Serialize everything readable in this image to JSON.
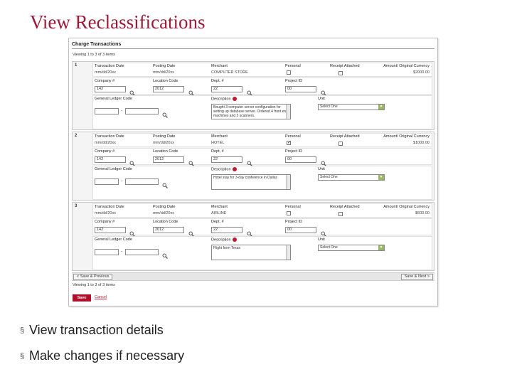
{
  "slide": {
    "title": "View Reclassifications",
    "bullets": [
      "View transaction details",
      "Make changes if necessary"
    ],
    "bullet_marker": "§"
  },
  "panel": {
    "header": "Charge Transactions",
    "viewing_top": "Viewing 1 to 3 of 3 items",
    "viewing_bottom": "Viewing 1 to 3 of 3 items",
    "prev_button": "< Save & Previous",
    "next_button": "Save & Next >",
    "save_button": "Save",
    "cancel_link": "Cancel",
    "labels": {
      "transaction_date": "Transaction Date",
      "posting_date": "Posting Date",
      "merchant": "Merchant",
      "personal": "Personal",
      "receipt_attached": "Receipt Attached",
      "amount": "Amount/ Original Currency",
      "company": "Company #",
      "location_code": "Location Code",
      "dept": "Dept. #",
      "project_id": "Project ID",
      "gl_code": "General Ledger Code",
      "description": "Description",
      "unit": "Unit"
    },
    "transactions": [
      {
        "num": "1",
        "transaction_date": "mm/dd/20xx",
        "posting_date": "mm/dd/20xx",
        "merchant": "COMPUTER STORE",
        "personal": false,
        "receipt": false,
        "amount": "$2000.00",
        "company": "142",
        "location": "2012",
        "dept": "22",
        "project": "00",
        "gl_left": "",
        "gl_right": "",
        "description": "Bought 3 computer server configuration for setting up database server. Ordered 4 front end machines and 2 scanners.",
        "unit": "Select One"
      },
      {
        "num": "2",
        "transaction_date": "mm/dd/20xx",
        "posting_date": "mm/dd/20xx",
        "merchant": "HOTEL",
        "personal": true,
        "receipt": false,
        "amount": "$1000.00",
        "company": "142",
        "location": "2012",
        "dept": "22",
        "project": "00",
        "gl_left": "",
        "gl_right": "",
        "description": "Hotel stay for 3-day conference in Dallas",
        "unit": "Select One"
      },
      {
        "num": "3",
        "transaction_date": "mm/dd/20xx",
        "posting_date": "mm/dd/20xx",
        "merchant": "AIRLINE",
        "personal": false,
        "receipt": false,
        "amount": "$600.00",
        "company": "142",
        "location": "2012",
        "dept": "22",
        "project": "00",
        "gl_left": "",
        "gl_right": "",
        "description": "Flight from Texas",
        "unit": "Select One"
      }
    ]
  },
  "colors": {
    "title": "#9b1c3a",
    "save_button": "#b0102a",
    "required_icon": "#c0182f"
  },
  "icons": [
    "magnifier-icon",
    "required-icon",
    "dropdown-arrow-icon",
    "checkbox-icon"
  ]
}
